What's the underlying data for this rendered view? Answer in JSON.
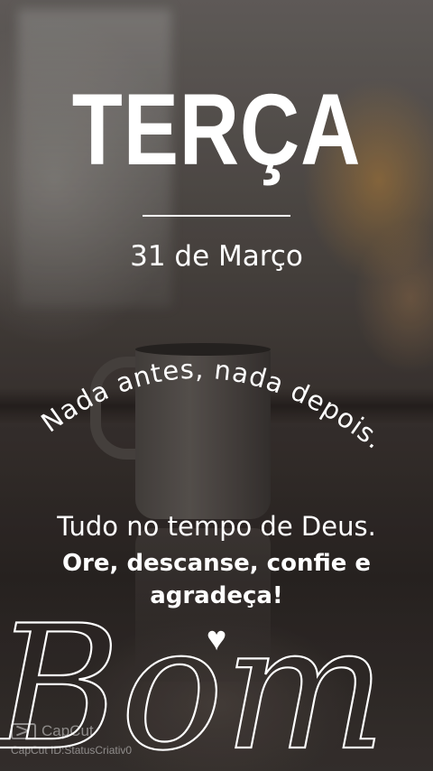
{
  "card": {
    "day": "TERÇA",
    "date": "31 de Março",
    "arc_text": "Nada antes, nada depois.",
    "line1": "Tudo no tempo de Deus.",
    "line2": "Ore, descanse, confie e agradeça!",
    "heart_icon": "heart-icon",
    "greeting": "Bom dia"
  },
  "watermark": {
    "brand": "CapCut",
    "id": "CapCut ID:StatusCriativ0"
  }
}
